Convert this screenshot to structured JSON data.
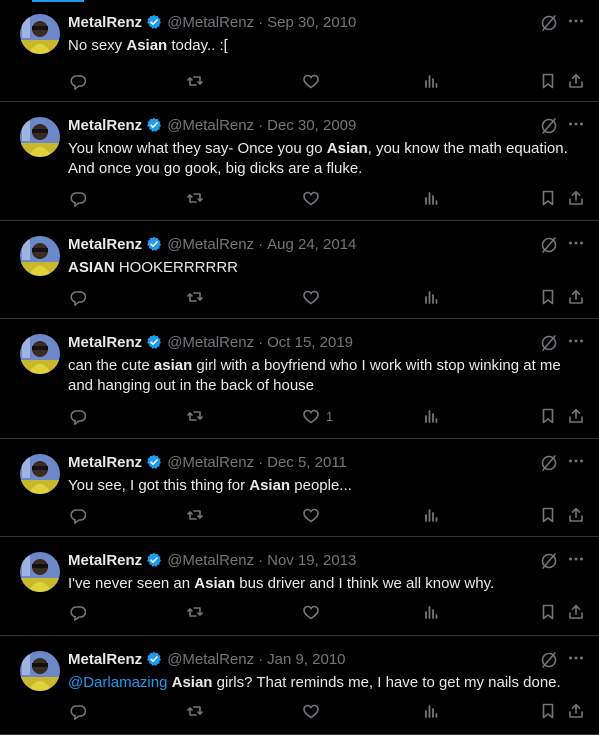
{
  "accent": "#1d9bf0",
  "muted": "#71767b",
  "text": "#e7e9ea",
  "tweets": [
    {
      "name": "MetalRenz",
      "handle": "@MetalRenz",
      "date": "Sep 30, 2010",
      "segments": [
        {
          "t": "No sexy "
        },
        {
          "t": "Asian",
          "b": true
        },
        {
          "t": " today.. :["
        }
      ],
      "likes": ""
    },
    {
      "name": "MetalRenz",
      "handle": "@MetalRenz",
      "date": "Dec 30, 2009",
      "segments": [
        {
          "t": "You know what they say- Once you go "
        },
        {
          "t": "Asian",
          "b": true
        },
        {
          "t": ", you know the math equation. And once you go gook, big dicks are a fluke."
        }
      ],
      "likes": ""
    },
    {
      "name": "MetalRenz",
      "handle": "@MetalRenz",
      "date": "Aug 24, 2014",
      "segments": [
        {
          "t": "ASIAN",
          "b": true
        },
        {
          "t": " HOOKERRRRRR"
        }
      ],
      "likes": ""
    },
    {
      "name": "MetalRenz",
      "handle": "@MetalRenz",
      "date": "Oct 15, 2019",
      "segments": [
        {
          "t": "can the cute "
        },
        {
          "t": "asian",
          "b": true
        },
        {
          "t": " girl with a boyfriend who I work with stop winking at me and hanging out in the back of house"
        }
      ],
      "likes": "1"
    },
    {
      "name": "MetalRenz",
      "handle": "@MetalRenz",
      "date": "Dec 5, 2011",
      "segments": [
        {
          "t": "You see, I got this thing for "
        },
        {
          "t": "Asian",
          "b": true
        },
        {
          "t": " people..."
        }
      ],
      "likes": ""
    },
    {
      "name": "MetalRenz",
      "handle": "@MetalRenz",
      "date": "Nov 19, 2013",
      "segments": [
        {
          "t": "I've never seen an "
        },
        {
          "t": "Asian",
          "b": true
        },
        {
          "t": " bus driver and I think we all know why."
        }
      ],
      "likes": ""
    },
    {
      "name": "MetalRenz",
      "handle": "@MetalRenz",
      "date": "Jan 9, 2010",
      "segments": [
        {
          "t": "@Darlamazing",
          "m": true
        },
        {
          "t": " "
        },
        {
          "t": "Asian",
          "b": true
        },
        {
          "t": " girls? That reminds me, I have to get my nails done."
        }
      ],
      "likes": ""
    }
  ]
}
